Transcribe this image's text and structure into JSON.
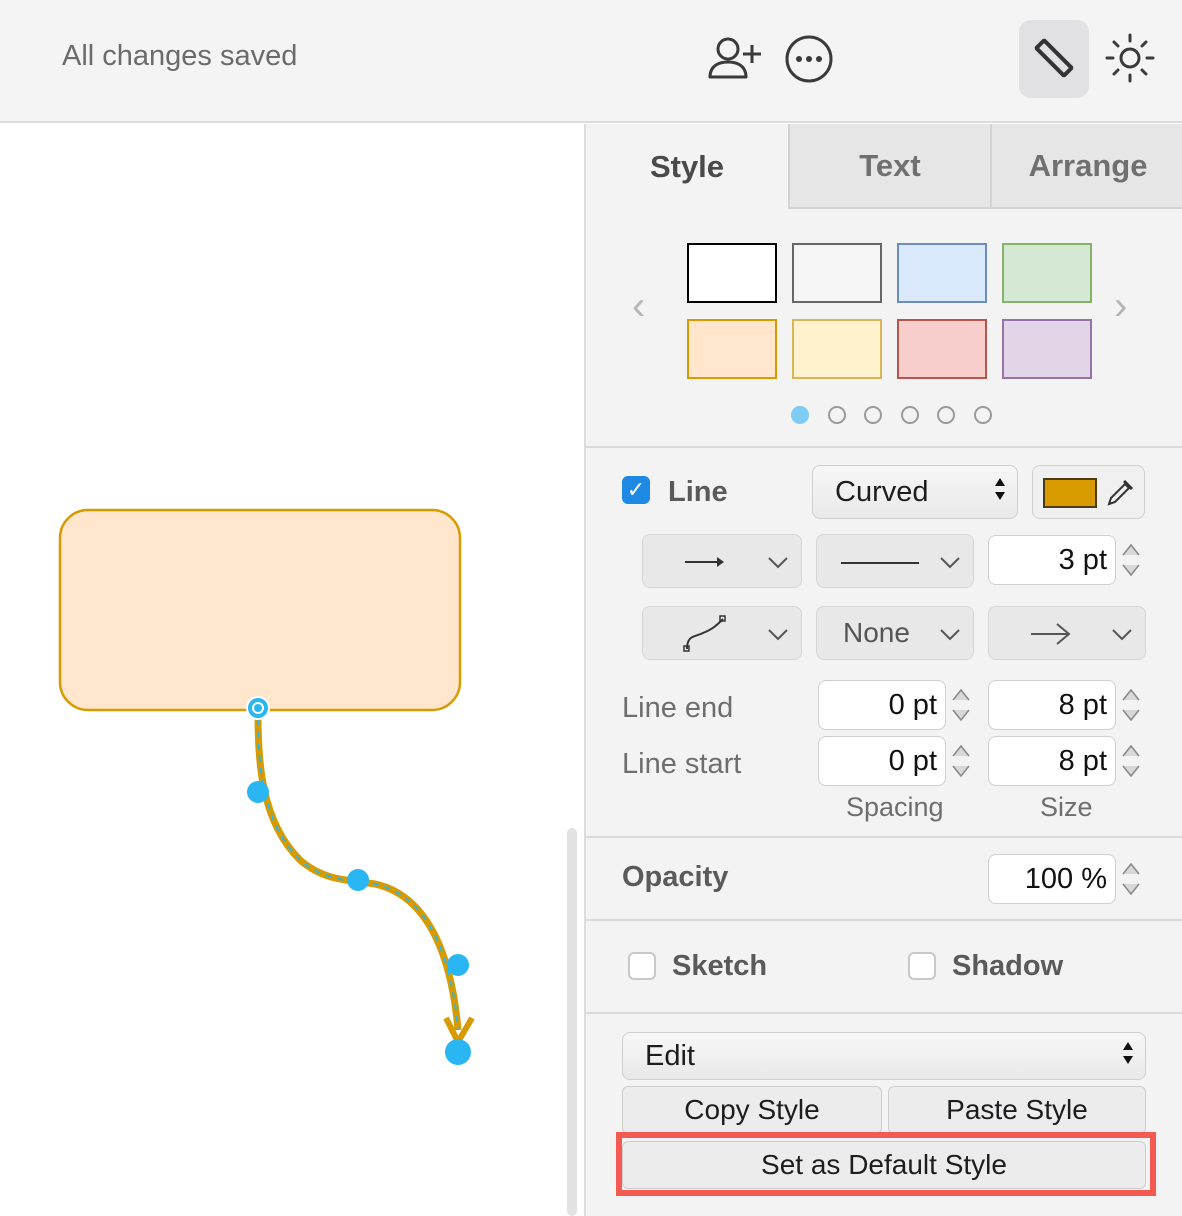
{
  "header": {
    "status": "All changes saved",
    "icons": [
      "add-user-icon",
      "more-icon",
      "format-panel-icon",
      "theme-icon"
    ]
  },
  "tabs": [
    {
      "label": "Style",
      "active": true
    },
    {
      "label": "Text",
      "active": false
    },
    {
      "label": "Arrange",
      "active": false
    }
  ],
  "palette": {
    "swatches": [
      {
        "fill": "#ffffff",
        "stroke": "#000000"
      },
      {
        "fill": "#f5f5f5",
        "stroke": "#666666"
      },
      {
        "fill": "#dae8fc",
        "stroke": "#6c8ebf"
      },
      {
        "fill": "#d5e8d4",
        "stroke": "#82b366"
      },
      {
        "fill": "#ffe6cc",
        "stroke": "#d79b00"
      },
      {
        "fill": "#fff2cc",
        "stroke": "#d6b656"
      },
      {
        "fill": "#f8cecc",
        "stroke": "#b85450"
      },
      {
        "fill": "#e1d5e7",
        "stroke": "#9673a6"
      }
    ],
    "pages": 6,
    "current_page": 1
  },
  "line": {
    "enabled_label": "Line",
    "checked": true,
    "type": "Curved",
    "color": "#d79b00",
    "width": "3 pt",
    "waypoints": "None",
    "line_end_label": "Line end",
    "line_start_label": "Line start",
    "line_end_spacing": "0 pt",
    "line_end_size": "8 pt",
    "line_start_spacing": "0 pt",
    "line_start_size": "8 pt",
    "spacing_label": "Spacing",
    "size_label": "Size"
  },
  "opacity": {
    "label": "Opacity",
    "value": "100 %"
  },
  "options": {
    "sketch_label": "Sketch",
    "shadow_label": "Shadow"
  },
  "actions": {
    "edit_label": "Edit",
    "copy_style": "Copy Style",
    "paste_style": "Paste Style",
    "set_default": "Set as Default Style"
  },
  "diagram": {
    "shape_fill": "#ffe6cc",
    "shape_stroke": "#d79b00",
    "edge_color": "#d79b00",
    "handle_color": "#29b6f2"
  }
}
